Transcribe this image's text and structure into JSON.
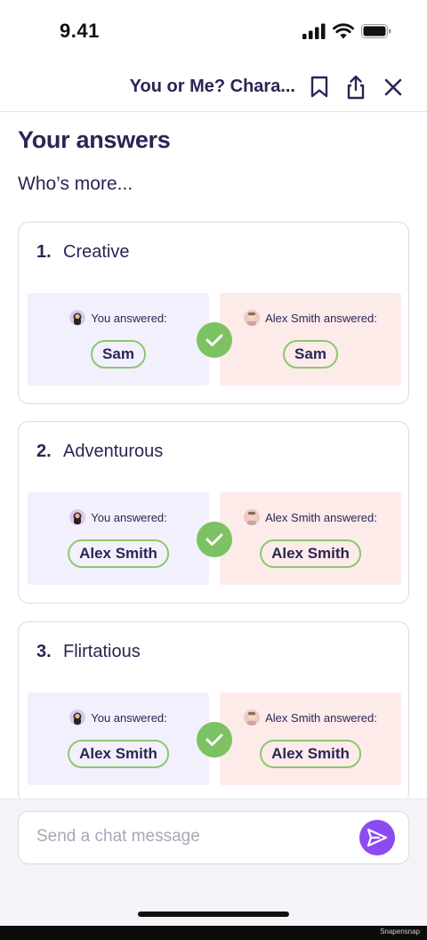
{
  "status_bar": {
    "time": "9.41"
  },
  "header": {
    "title": "You or Me? Chara..."
  },
  "page": {
    "title": "Your answers",
    "subtitle": "Who’s more..."
  },
  "questions": [
    {
      "number": "1.",
      "label": "Creative",
      "you_label": "You answered:",
      "you_answer": "Sam",
      "other_label": "Alex Smith answered:",
      "other_answer": "Sam"
    },
    {
      "number": "2.",
      "label": "Adventurous",
      "you_label": "You answered:",
      "you_answer": "Alex Smith",
      "other_label": "Alex Smith answered:",
      "other_answer": "Alex Smith"
    },
    {
      "number": "3.",
      "label": "Flirtatious",
      "you_label": "You answered:",
      "you_answer": "Alex Smith",
      "other_label": "Alex Smith answered:",
      "other_answer": "Alex Smith"
    }
  ],
  "chat": {
    "placeholder": "Send a chat message"
  },
  "footer": {
    "credit": "Snapensnap"
  },
  "colors": {
    "primary_text": "#2a2555",
    "accent_purple": "#8d4af0",
    "match_green": "#7cc262",
    "you_bg": "#f3f0fd",
    "other_bg": "#fdebea"
  },
  "icons": [
    "signal-icon",
    "wifi-icon",
    "battery-icon",
    "bookmark-icon",
    "share-icon",
    "close-icon",
    "avatar-you",
    "avatar-alex",
    "check-icon",
    "send-icon"
  ]
}
